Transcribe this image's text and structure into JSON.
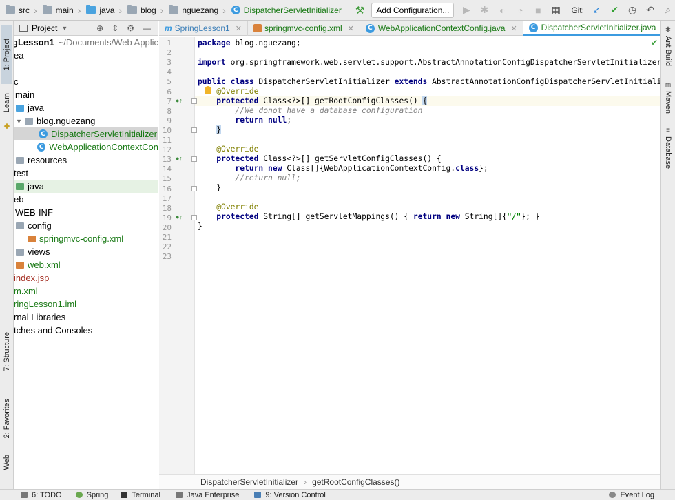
{
  "navbar": {
    "crumbs": [
      "src",
      "main",
      "java",
      "blog",
      "nguezang",
      "DispatcherServletInitializer"
    ],
    "add_configuration": "Add Configuration...",
    "git_label": "Git:"
  },
  "left_strip": {
    "tabs": [
      "1: Project",
      "Learn",
      "7: Structure",
      "2: Favorites",
      "Web"
    ]
  },
  "project_panel": {
    "title": "Project",
    "tree": [
      {
        "label": "gLesson1",
        "suffix": "~/Documents/Web Applic"
      },
      {
        "label": "ea"
      },
      {
        "label": "c"
      },
      {
        "label": "main"
      },
      {
        "label": "java"
      },
      {
        "label": "blog.nguezang"
      },
      {
        "label": "DispatcherServletInitializer"
      },
      {
        "label": "WebApplicationContextCon"
      },
      {
        "label": "resources"
      },
      {
        "label": "test"
      },
      {
        "label": "java"
      },
      {
        "label": "eb"
      },
      {
        "label": "WEB-INF"
      },
      {
        "label": "config"
      },
      {
        "label": "springmvc-config.xml"
      },
      {
        "label": "views"
      },
      {
        "label": "web.xml"
      },
      {
        "label": "index.jsp"
      },
      {
        "label": "m.xml"
      },
      {
        "label": "ringLesson1.iml"
      },
      {
        "label": "rnal Libraries"
      },
      {
        "label": "tches and Consoles"
      }
    ]
  },
  "editor_tabs": [
    {
      "label": "SpringLesson1"
    },
    {
      "label": "springmvc-config.xml"
    },
    {
      "label": "WebApplicationContextConfig.java"
    },
    {
      "label": "DispatcherServletInitializer.java"
    }
  ],
  "editor": {
    "line_numbers": [
      "1",
      "2",
      "3",
      "4",
      "5",
      "6",
      "7",
      "8",
      "9",
      "10",
      "11",
      "12",
      "13",
      "14",
      "15",
      "16",
      "17",
      "18",
      "19",
      "20",
      "21",
      "22",
      "23"
    ],
    "lines": {
      "l1_kw": "package",
      "l1_rest": " blog.nguezang;",
      "l3_kw": "import",
      "l3_rest": " org.springframework.web.servlet.support.AbstractAnnotationConfigDispatcherServletInitializer;",
      "l5_kw1": "public class",
      "l5_name": " DispatcherServletInitializer ",
      "l5_kw2": "extends",
      "l5_rest": " AbstractAnnotationConfigDispatcherServletInitializer {",
      "l6_ann": "@Override",
      "l7_kw": "protected",
      "l7_rest": " Class<?>[] getRootConfigClasses() ",
      "l7_brace": "{",
      "l8_cm": "//We donot have a database configuration",
      "l9_kw1": "return",
      "l9_kw2": "null",
      "l9_end": ";",
      "l10_brace": "}",
      "l12_ann": "@Override",
      "l13_kw": "protected",
      "l13_rest": " Class<?>[] getServletConfigClasses() {",
      "l14_kw1": "return",
      "l14_kw2": "new",
      "l14_mid": " Class[]{WebApplicationContextConfig.",
      "l14_kw3": "class",
      "l14_end": "};",
      "l15_cm": "//return null;",
      "l16": "}",
      "l18_ann": "@Override",
      "l19_kw": "protected",
      "l19_rest": " String[] getServletMappings() { ",
      "l19_kw1": "return",
      "l19_kw2": "new",
      "l19_mid": " String[]{",
      "l19_str": "\"/\"",
      "l19_end": "}; }",
      "l20": "}"
    }
  },
  "editor_breadcrumb": [
    "DispatcherServletInitializer",
    "getRootConfigClasses()"
  ],
  "right_strip": {
    "tabs": [
      "Ant Build",
      "Maven",
      "Database"
    ]
  },
  "bottom_bar": {
    "tabs": [
      "6: TODO",
      "Spring",
      "Terminal",
      "Java Enterprise",
      "9: Version Control"
    ],
    "event_log": "Event Log"
  },
  "colors": {
    "keyword": "#000080",
    "annotation": "#808000",
    "comment": "#808080",
    "string": "#008000",
    "selection_blue": "#3c9be0"
  }
}
